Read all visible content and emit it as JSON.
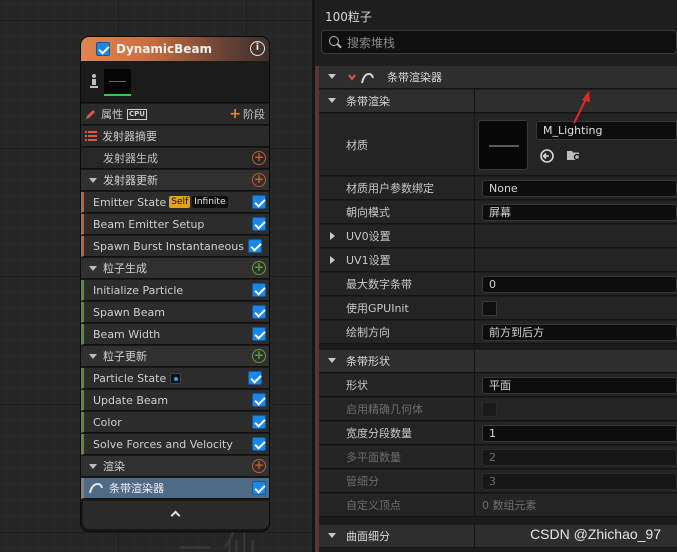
{
  "node": {
    "title": "DynamicBeam",
    "properties_label": "属性",
    "cpu_label": "CPU",
    "stage_button": "阶段",
    "summary_label": "发射器摘要",
    "rows": [
      {
        "label": "发射器生成"
      },
      {
        "label": "发射器更新"
      },
      {
        "label": "Emitter State",
        "badge_self": "Self",
        "badge_infinite": "Infinite"
      },
      {
        "label": "Beam Emitter Setup"
      },
      {
        "label": "Spawn Burst Instantaneous"
      },
      {
        "label": "粒子生成"
      },
      {
        "label": "Initialize Particle"
      },
      {
        "label": "Spawn Beam"
      },
      {
        "label": "Beam Width"
      },
      {
        "label": "粒子更新"
      },
      {
        "label": "Particle State"
      },
      {
        "label": "Update Beam"
      },
      {
        "label": "Color"
      },
      {
        "label": "Solve Forces and Velocity"
      },
      {
        "label": "渲染"
      },
      {
        "label": "条带渲染器"
      }
    ]
  },
  "panel": {
    "title": "100粒子",
    "search_placeholder": "搜索堆栈",
    "top_category": "条带渲染器",
    "section_ribbon_render": "条带渲染",
    "material_label": "材质",
    "material_value": "M_Lighting",
    "props": [
      {
        "label": "材质用户参数绑定",
        "value": "None"
      },
      {
        "label": "朝向模式",
        "value": "屏幕"
      },
      {
        "label": "UV0设置"
      },
      {
        "label": "UV1设置"
      },
      {
        "label": "最大数字条带",
        "value": "0"
      },
      {
        "label": "使用GPUInit"
      },
      {
        "label": "绘制方向",
        "value": "前方到后方"
      }
    ],
    "section_ribbon_shape": "条带形状",
    "shape_props": [
      {
        "label": "形状",
        "value": "平面"
      },
      {
        "label": "启用精确几何体"
      },
      {
        "label": "宽度分段数量",
        "value": "1"
      },
      {
        "label": "多平面数量",
        "value": "2"
      },
      {
        "label": "管细分",
        "value": "3"
      },
      {
        "label": "自定义顶点",
        "value": "0 数组元素"
      }
    ],
    "section_curve_subdivision": "曲面细分"
  },
  "watermark": "CSDN @Zhichao_97"
}
